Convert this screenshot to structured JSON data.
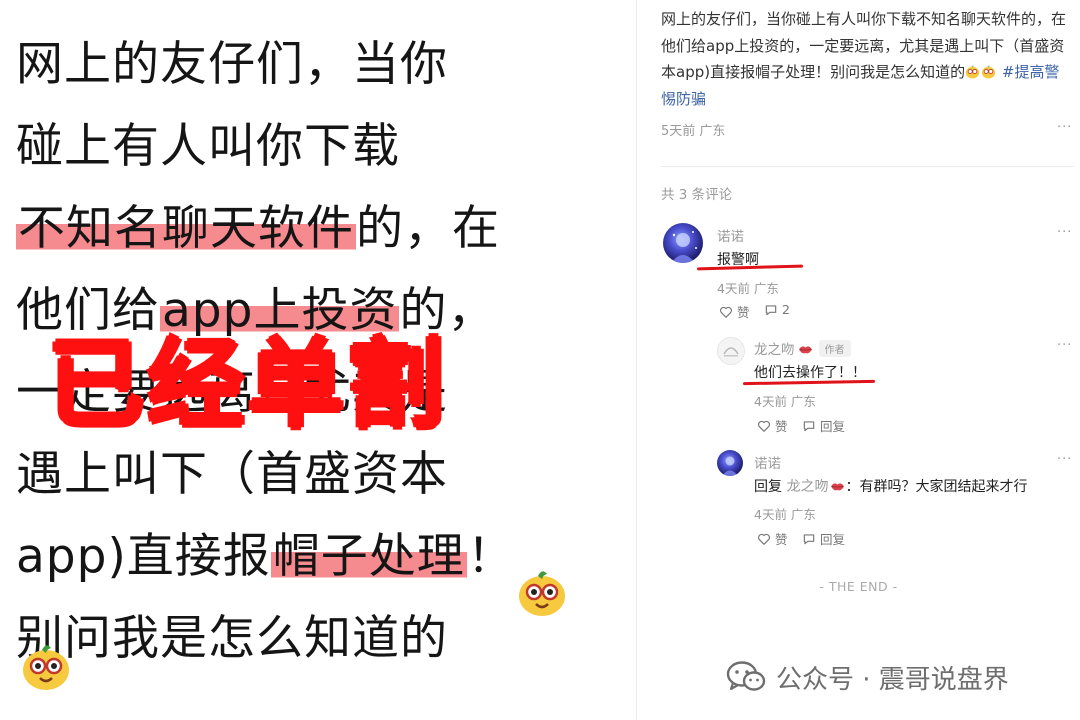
{
  "left_image": {
    "lines": [
      {
        "segments": [
          {
            "text": "网上的友仔们，当你",
            "highlight": false
          }
        ]
      },
      {
        "segments": [
          {
            "text": "碰上有人叫你下载",
            "highlight": false
          }
        ]
      },
      {
        "segments": [
          {
            "text": "不知名聊天软件",
            "highlight": true
          },
          {
            "text": "的，在",
            "highlight": false
          }
        ]
      },
      {
        "segments": [
          {
            "text": "他们给",
            "highlight": false
          },
          {
            "text": "app上投资",
            "highlight": true
          },
          {
            "text": "的，",
            "highlight": false
          }
        ]
      },
      {
        "segments": [
          {
            "text": "一定要远离，尤其是",
            "highlight": false
          }
        ]
      },
      {
        "segments": [
          {
            "text": "遇上叫下（首盛资本",
            "highlight": false
          }
        ]
      },
      {
        "segments": [
          {
            "text": "app)直接报",
            "highlight": false
          },
          {
            "text": "帽子处理",
            "highlight": true
          },
          {
            "text": "！",
            "highlight": false
          }
        ]
      },
      {
        "segments": [
          {
            "text": "别问我是怎么知道的",
            "highlight": false
          }
        ]
      }
    ],
    "stamp_text": "已经单割",
    "highlight_color": "#f58a8f",
    "stamp_color": "#ff1010"
  },
  "post": {
    "text": "网上的友仔们，当你碰上有人叫你下载不知名聊天软件的，在他们给app上投资的，一定要远离，尤其是遇上叫下（首盛资本app)直接报帽子处理！别问我是怎么知道的",
    "hashtag": "#提高警惕防骗",
    "meta": "5天前 广东",
    "more_icon": "more-dots-icon",
    "tag_color": "#3d63a8"
  },
  "comments": {
    "count_label": "共 3 条评论",
    "items": [
      {
        "name": "诺诺",
        "text": "报警啊",
        "meta": "4天前 广东",
        "like_label": "赞",
        "reply_count": "2"
      },
      {
        "name": "龙之吻",
        "badge": "作者",
        "text": "他们去操作了！！",
        "meta": "4天前 广东",
        "like_label": "赞",
        "reply_label": "回复"
      },
      {
        "name": "诺诺",
        "reply_prefix": "回复",
        "reply_to": "龙之吻",
        "text": "：有群吗？大家团结起来才行",
        "meta": "4天前 广东",
        "like_label": "赞",
        "reply_label": "回复"
      }
    ]
  },
  "the_end": "- THE END -",
  "watermark": {
    "text": "公众号 · 震哥说盘界",
    "icon": "wechat-icon"
  },
  "underline_color": "#e0121a"
}
